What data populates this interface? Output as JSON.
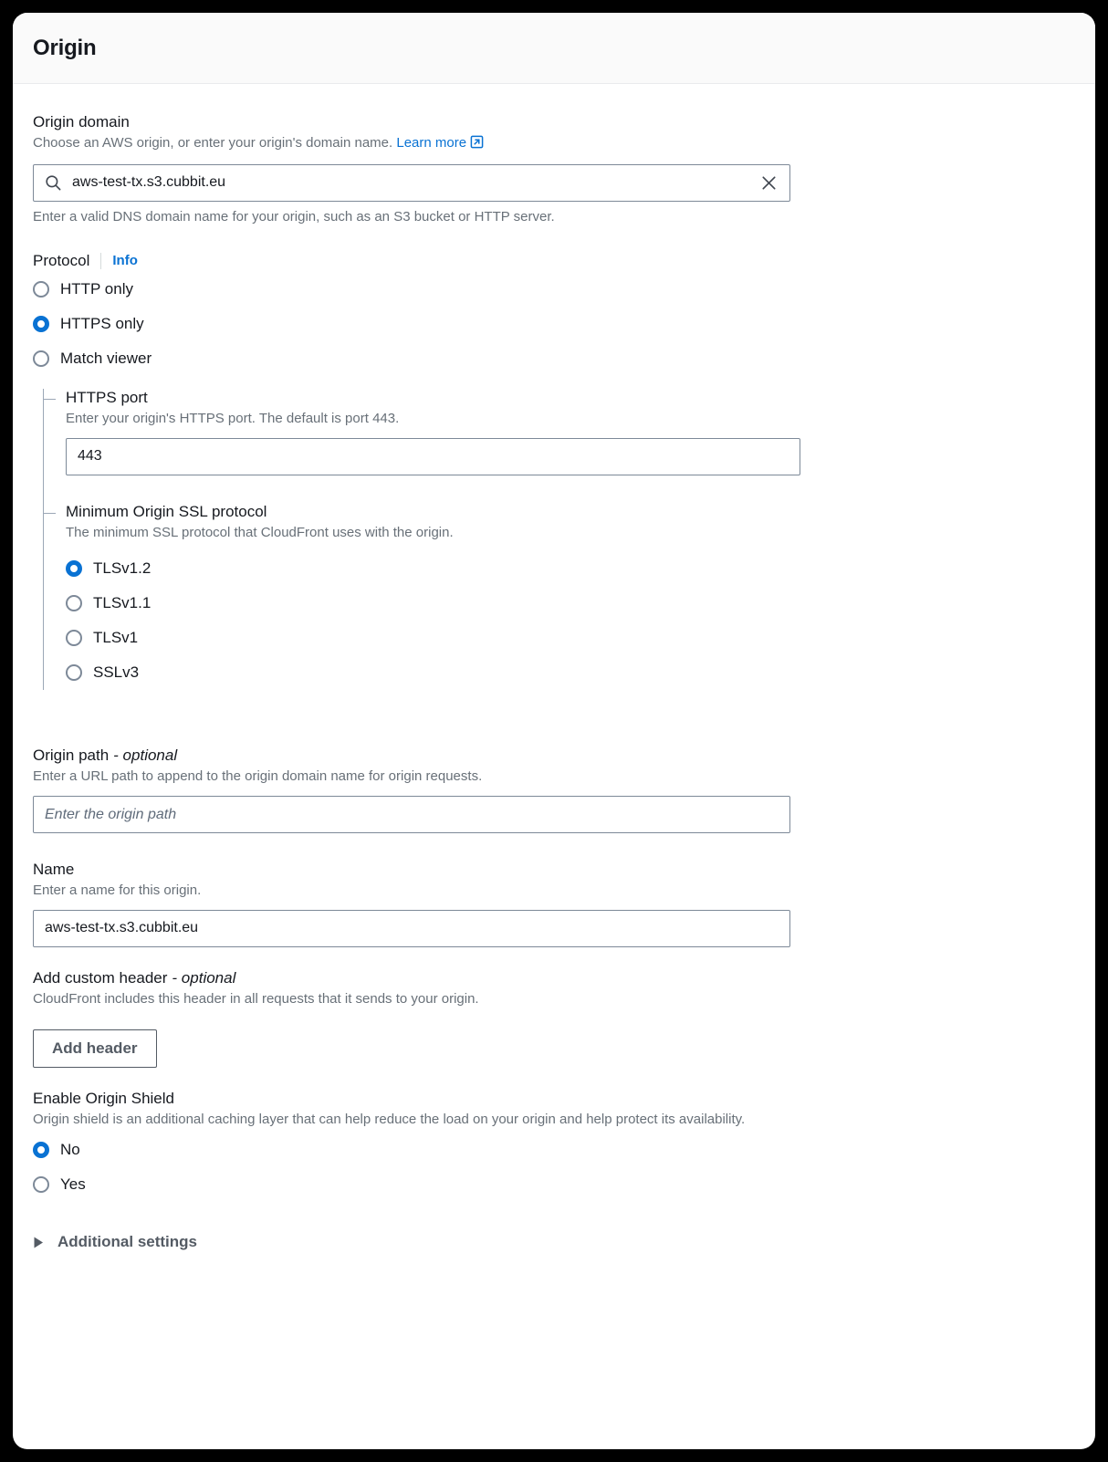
{
  "panel": {
    "title": "Origin"
  },
  "origin_domain": {
    "label": "Origin domain",
    "description_prefix": "Choose an AWS origin, or enter your origin's domain name.",
    "learn_more": "Learn more",
    "value": "aws-test-tx.s3.cubbit.eu",
    "hint": "Enter a valid DNS domain name for your origin, such as an S3 bucket or HTTP server.",
    "search_icon": "search-icon",
    "clear_icon": "close-icon",
    "external_link_icon": "external-link-icon"
  },
  "protocol": {
    "label": "Protocol",
    "info_label": "Info",
    "selected": "HTTPS only",
    "options": [
      {
        "label": "HTTP only",
        "checked": false
      },
      {
        "label": "HTTPS only",
        "checked": true
      },
      {
        "label": "Match viewer",
        "checked": false
      }
    ]
  },
  "https_port": {
    "label": "HTTPS port",
    "description": "Enter your origin's HTTPS port. The default is port 443.",
    "value": "443"
  },
  "min_ssl": {
    "label": "Minimum Origin SSL protocol",
    "description": "The minimum SSL protocol that CloudFront uses with the origin.",
    "selected": "TLSv1.2",
    "options": [
      {
        "label": "TLSv1.2",
        "checked": true
      },
      {
        "label": "TLSv1.1",
        "checked": false
      },
      {
        "label": "TLSv1",
        "checked": false
      },
      {
        "label": "SSLv3",
        "checked": false
      }
    ]
  },
  "origin_path": {
    "label": "Origin path",
    "optional_suffix": "- optional",
    "description": "Enter a URL path to append to the origin domain name for origin requests.",
    "value": "",
    "placeholder": "Enter the origin path"
  },
  "name": {
    "label": "Name",
    "description": "Enter a name for this origin.",
    "value": "aws-test-tx.s3.cubbit.eu"
  },
  "custom_header": {
    "label": "Add custom header",
    "optional_suffix": "- optional",
    "description": "CloudFront includes this header in all requests that it sends to your origin.",
    "add_button": "Add header"
  },
  "origin_shield": {
    "label": "Enable Origin Shield",
    "description": "Origin shield is an additional caching layer that can help reduce the load on your origin and help protect its availability.",
    "selected": "No",
    "options": [
      {
        "label": "No",
        "checked": true
      },
      {
        "label": "Yes",
        "checked": false
      }
    ]
  },
  "additional_settings": {
    "label": "Additional settings",
    "expanded": false,
    "caret_icon": "caret-right-icon"
  },
  "colors": {
    "accent": "#0972d3",
    "text": "#16191f",
    "muted": "#687078",
    "border": "#7d8998",
    "header_bg": "#fafafa"
  }
}
